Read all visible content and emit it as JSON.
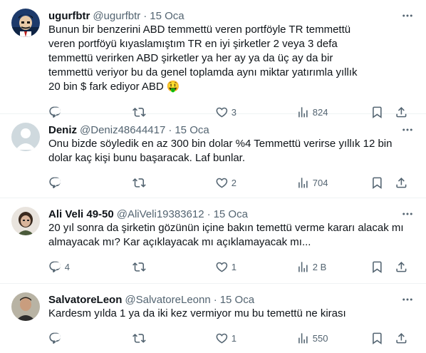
{
  "tweets": [
    {
      "name": "ugurfbtr",
      "handle": "@ugurfbtr",
      "time": "15 Oca",
      "text": "Bunun bir benzerini ABD temmettü veren portföyle TR temmettü veren portföyü kıyaslamıştım TR en iyi şirketler 2 veya 3 defa temmettü verirken ABD şirketler ya her ay ya da üç ay da bir temmettü veriyor bu da genel toplamda aynı miktar yatırımla yıllık 20 bin $ fark ediyor ABD 🤑",
      "replies": "",
      "retweets": "",
      "likes": "3",
      "views": "824",
      "avatar_bg": "#1d3a6b"
    },
    {
      "name": "Deniz",
      "handle": "@Deniz48644417",
      "time": "15 Oca",
      "text": "Onu bizde söyledik en az 300 bin dolar %4 Temmettü verirse yıllık 12 bin dolar kaç kişi bunu başaracak. Laf bunlar.",
      "replies": "",
      "retweets": "",
      "likes": "2",
      "views": "704",
      "avatar_bg": "#cfd9de"
    },
    {
      "name": "Ali Veli 49-50",
      "handle": "@AliVeli19383612",
      "time": "15 Oca",
      "text": "20 yıl sonra da şirketin gözünün içine bakın temettü verme kararı alacak mı almayacak mı? Kar açıklayacak mı açıklamayacak mı...",
      "replies": "4",
      "retweets": "",
      "likes": "1",
      "views": "2 B",
      "avatar_bg": "#6b5a4a"
    },
    {
      "name": "SalvatoreLeon",
      "handle": "@SalvatoreLeonn",
      "time": "15 Oca",
      "text": "Kardesm yılda 1 ya da iki kez vermiyor mu bu temettü ne kirası",
      "replies": "",
      "retweets": "",
      "likes": "1",
      "views": "550",
      "avatar_bg": "#8a8a7a"
    }
  ],
  "separator": "·",
  "icons": {
    "reply": "reply-icon",
    "retweet": "retweet-icon",
    "like": "heart-icon",
    "views": "views-chart-icon",
    "bookmark": "bookmark-icon",
    "share": "share-icon",
    "more": "more-dots-icon"
  }
}
